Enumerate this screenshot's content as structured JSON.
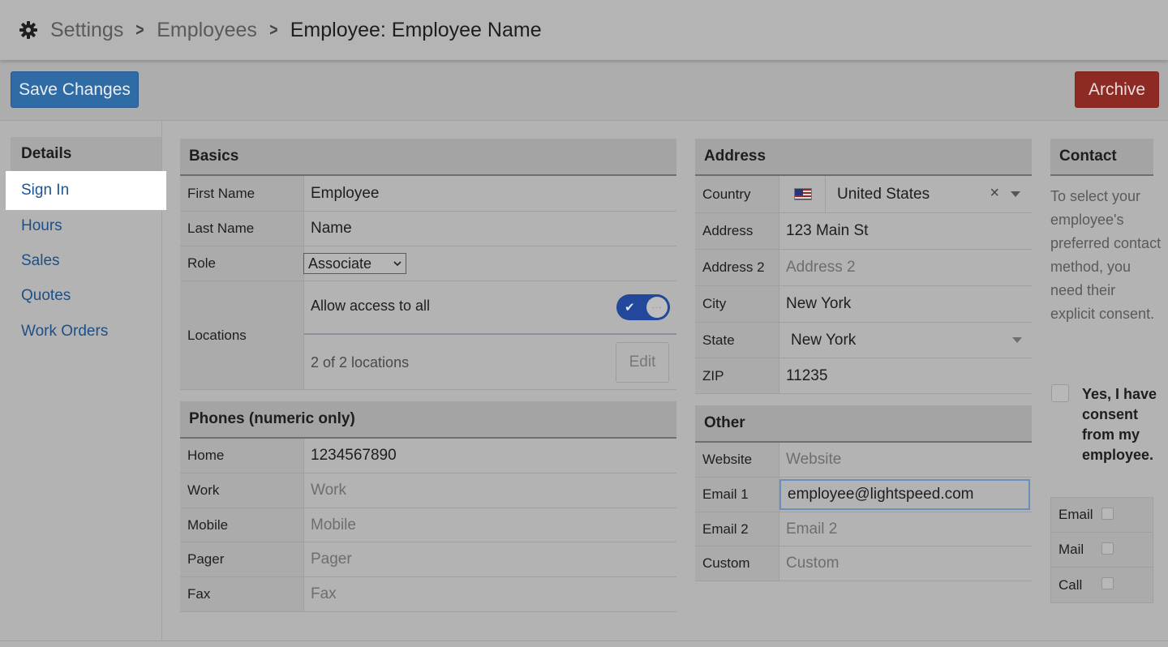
{
  "breadcrumb": {
    "items": [
      "Settings",
      "Employees",
      "Employee: Employee Name"
    ]
  },
  "toolbar": {
    "save_label": "Save Changes",
    "archive_label": "Archive"
  },
  "sidebar": {
    "header": "Details",
    "items": [
      {
        "label": "Sign In"
      },
      {
        "label": "Hours"
      },
      {
        "label": "Sales"
      },
      {
        "label": "Quotes"
      },
      {
        "label": "Work Orders"
      }
    ]
  },
  "basics": {
    "title": "Basics",
    "first_name_label": "First Name",
    "first_name_value": "Employee",
    "last_name_label": "Last Name",
    "last_name_value": "Name",
    "role_label": "Role",
    "role_value": "Associate",
    "locations_label": "Locations",
    "allow_access_label": "Allow access to all",
    "locations_count": "2 of 2 locations",
    "edit_label": "Edit"
  },
  "phones": {
    "title": "Phones (numeric only)",
    "rows": [
      {
        "label": "Home",
        "value": "1234567890",
        "placeholder": ""
      },
      {
        "label": "Work",
        "value": "",
        "placeholder": "Work"
      },
      {
        "label": "Mobile",
        "value": "",
        "placeholder": "Mobile"
      },
      {
        "label": "Pager",
        "value": "",
        "placeholder": "Pager"
      },
      {
        "label": "Fax",
        "value": "",
        "placeholder": "Fax"
      }
    ]
  },
  "address": {
    "title": "Address",
    "country_label": "Country",
    "country_value": "United States",
    "clear_glyph": "×",
    "address_label": "Address",
    "address_value": "123 Main St",
    "address2_label": "Address 2",
    "address2_placeholder": "Address 2",
    "city_label": "City",
    "city_value": "New York",
    "state_label": "State",
    "state_value": "New York",
    "zip_label": "ZIP",
    "zip_value": "11235"
  },
  "other": {
    "title": "Other",
    "website_label": "Website",
    "website_placeholder": "Website",
    "email1_label": "Email 1",
    "email1_value": "employee@lightspeed.com",
    "email2_label": "Email 2",
    "email2_placeholder": "Email 2",
    "custom_label": "Custom",
    "custom_placeholder": "Custom"
  },
  "contact": {
    "title": "Contact",
    "description": "To select your employee's preferred contact method, you need their explicit consent.",
    "consent_label": "Yes, I have consent from my employee.",
    "methods": [
      "Email",
      "Mail",
      "Call"
    ]
  },
  "colors": {
    "save_button": "#2f6ca6",
    "archive_button": "#8e2a24",
    "toggle_on": "#23479a",
    "link": "#1e4f85"
  }
}
